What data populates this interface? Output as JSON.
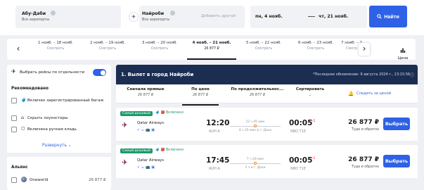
{
  "search": {
    "origin": {
      "title": "Абу-Даби",
      "sub": "Все аэропорты"
    },
    "destination": {
      "title": "Найроби",
      "sub": "Все аэропорты"
    },
    "add_other_placeholder": "Добавить другой",
    "depart_date": "пн, 4 нояб.",
    "return_date": "чт, 21 нояб.",
    "find_label": "Найти"
  },
  "dates": {
    "cells": [
      {
        "range": "1 нояб. – 18 нояб.",
        "price": "Смотреть",
        "active": false
      },
      {
        "range": "2 нояб. – 19 нояб.",
        "price": "Смотреть",
        "active": false
      },
      {
        "range": "3 нояб. – 20 нояб.",
        "price": "Смотреть",
        "active": false
      },
      {
        "range": "4 нояб. – 21 нояб.",
        "price": "26 877 ₽",
        "active": true
      },
      {
        "range": "5 нояб. – 22 нояб.",
        "price": "Смотреть",
        "active": false
      },
      {
        "range": "6 нояб. – 23 нояб.",
        "price": "Смотреть",
        "active": false
      },
      {
        "range": "7 нояб. – 2",
        "price": "Смотр",
        "active": false
      }
    ],
    "price_graph_label": "Цена"
  },
  "filters": {
    "separate_toggle_label": "Выбрать рейсы по отдельности",
    "recommended_title": "Рекомендовано",
    "options": [
      {
        "label": "Включен зарегистрированный багаж"
      },
      {
        "label": "Скрыть лоукостеры"
      },
      {
        "label": "Включена ручная кладь"
      }
    ],
    "expand_label": "Развернуть",
    "alliances_title": "Альянс",
    "alliance": {
      "name": "Oneworld",
      "price": "26 877 ₽"
    }
  },
  "results": {
    "title": "1. Вылет в город Найроби",
    "last_update": "*Последнее обновление: 9 августа 2024 г., 13:15:56",
    "sort": [
      {
        "label": "Сначала прямые",
        "sub": "26 877 ₽"
      },
      {
        "label": "По цене",
        "sub": "26 877 ₽"
      },
      {
        "label": "По продолжительнос...",
        "sub": "26 877 ₽"
      },
      {
        "label": "Сортировать",
        "sub": ""
      }
    ],
    "track_price": "Следить за ценой",
    "flights": [
      {
        "badge": "Самый дешевый",
        "included": "Включено",
        "airline": "Qatar Airways",
        "dep_time": "12:20",
        "dep_airport": "AUH A",
        "duration": "12 ч 45 мин",
        "stopover": "6 ч 25 мин в г. Доха",
        "arr_time": "00:05",
        "arr_plus": "+1",
        "arr_airport": "NBO T1E",
        "price": "26 877 ₽",
        "price_sub": "Туда и обратно",
        "choose": "Выбрать"
      },
      {
        "badge": "Самый дешевый",
        "included": "Включено",
        "airline": "Qatar Airways",
        "dep_time": "17:45",
        "dep_airport": "AUH A",
        "duration": "7 ч 20 мин",
        "stopover": "1 ч в г. Доха",
        "arr_time": "00:05",
        "arr_plus": "+1",
        "arr_airport": "NBO T1E",
        "price": "26 877 ₽",
        "price_sub": "Туда и обратно",
        "choose": "Выбрать"
      }
    ]
  },
  "colors": {
    "accent": "#2e61e6",
    "header_bg": "#1c2d52",
    "badge_green": "#1e9a6c",
    "stop_orange": "#f08a1c"
  }
}
